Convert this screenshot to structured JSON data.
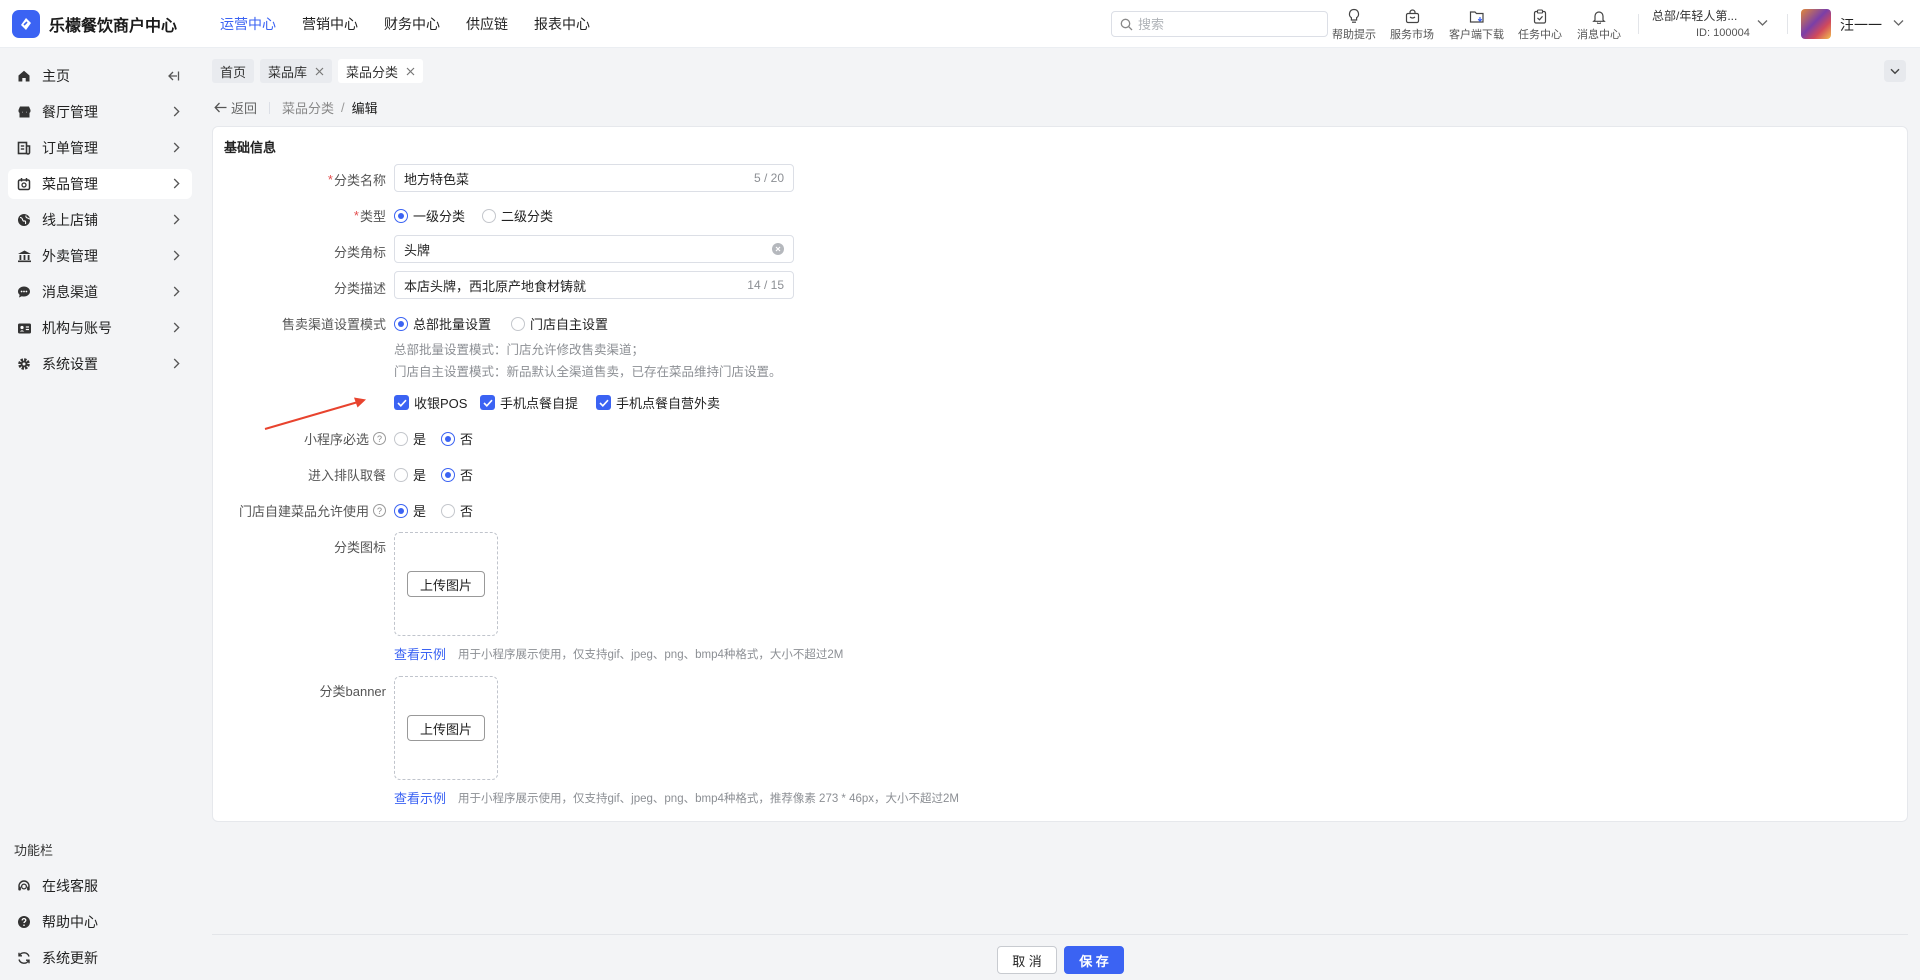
{
  "app": {
    "title": "乐檬餐饮商户中心"
  },
  "top_nav": [
    {
      "label": "运营中心",
      "active": true
    },
    {
      "label": "营销中心",
      "active": false
    },
    {
      "label": "财务中心",
      "active": false
    },
    {
      "label": "供应链",
      "active": false
    },
    {
      "label": "报表中心",
      "active": false
    }
  ],
  "search": {
    "placeholder": "搜索",
    "value": ""
  },
  "tools": [
    {
      "label": "帮助提示",
      "icon": "lightbulb-icon"
    },
    {
      "label": "服务市场",
      "icon": "shopping-bag-icon"
    },
    {
      "label": "客户端下载",
      "icon": "folder-download-icon"
    },
    {
      "label": "任务中心",
      "icon": "clipboard-icon"
    },
    {
      "label": "消息中心",
      "icon": "bell-icon"
    }
  ],
  "store": {
    "name": "总部/年轻人第...",
    "id": "ID: 100004"
  },
  "user": {
    "name": "汪一一"
  },
  "sidebar": {
    "items": [
      {
        "label": "主页",
        "icon": "home-icon"
      },
      {
        "label": "餐厅管理",
        "icon": "store-icon"
      },
      {
        "label": "订单管理",
        "icon": "order-icon"
      },
      {
        "label": "菜品管理",
        "icon": "dish-icon",
        "active": true
      },
      {
        "label": "线上店铺",
        "icon": "globe-icon"
      },
      {
        "label": "外卖管理",
        "icon": "bank-icon"
      },
      {
        "label": "消息渠道",
        "icon": "chat-icon"
      },
      {
        "label": "机构与账号",
        "icon": "id-card-icon"
      },
      {
        "label": "系统设置",
        "icon": "gear-icon"
      }
    ],
    "section_title": "功能栏",
    "function_items": [
      {
        "label": "在线客服",
        "icon": "headset-icon"
      },
      {
        "label": "帮助中心",
        "icon": "question-icon"
      },
      {
        "label": "系统更新",
        "icon": "refresh-icon"
      }
    ]
  },
  "tabs": [
    {
      "label": "首页",
      "closable": false
    },
    {
      "label": "菜品库",
      "closable": true
    },
    {
      "label": "菜品分类",
      "closable": true,
      "active": true
    }
  ],
  "breadcrumb": {
    "back": "返回",
    "parent": "菜品分类",
    "sep": "/",
    "current": "编辑"
  },
  "form": {
    "section_title": "基础信息",
    "name": {
      "label": "分类名称",
      "value": "地方特色菜",
      "count": "5 / 20"
    },
    "type": {
      "label": "类型",
      "options": [
        "一级分类",
        "二级分类"
      ],
      "selected": "一级分类"
    },
    "badge": {
      "label": "分类角标",
      "value": "头牌"
    },
    "desc": {
      "label": "分类描述",
      "value": "本店头牌，西北原产地食材铸就",
      "count": "14 / 15"
    },
    "channel_mode": {
      "label": "售卖渠道设置模式",
      "options": [
        "总部批量设置",
        "门店自主设置"
      ],
      "selected": "总部批量设置",
      "hint1": "总部批量设置模式：门店允许修改售卖渠道；",
      "hint2": "门店自主设置模式：新品默认全渠道售卖，已存在菜品维持门店设置。"
    },
    "channels": [
      "收银POS",
      "手机点餐自提",
      "手机点餐自营外卖"
    ],
    "mini_required": {
      "label": "小程序必选",
      "options": [
        "是",
        "否"
      ],
      "selected": "否"
    },
    "queue": {
      "label": "进入排队取餐",
      "options": [
        "是",
        "否"
      ],
      "selected": "否"
    },
    "store_allow": {
      "label": "门店自建菜品允许使用",
      "options": [
        "是",
        "否"
      ],
      "selected": "是"
    },
    "icon_upload": {
      "label": "分类图标",
      "button": "上传图片",
      "example": "查看示例",
      "note": "用于小程序展示使用，仅支持gif、jpeg、png、bmp4种格式，大小不超过2M"
    },
    "banner_upload": {
      "label": "分类banner",
      "button": "上传图片",
      "example": "查看示例",
      "note": "用于小程序展示使用，仅支持gif、jpeg、png、bmp4种格式，推荐像素 273 * 46px，大小不超过2M"
    }
  },
  "footer": {
    "cancel": "取 消",
    "save": "保 存"
  },
  "colors": {
    "accent": "#3b63f3",
    "required": "#e34d4d",
    "annotation_arrow": "#e8432e"
  }
}
